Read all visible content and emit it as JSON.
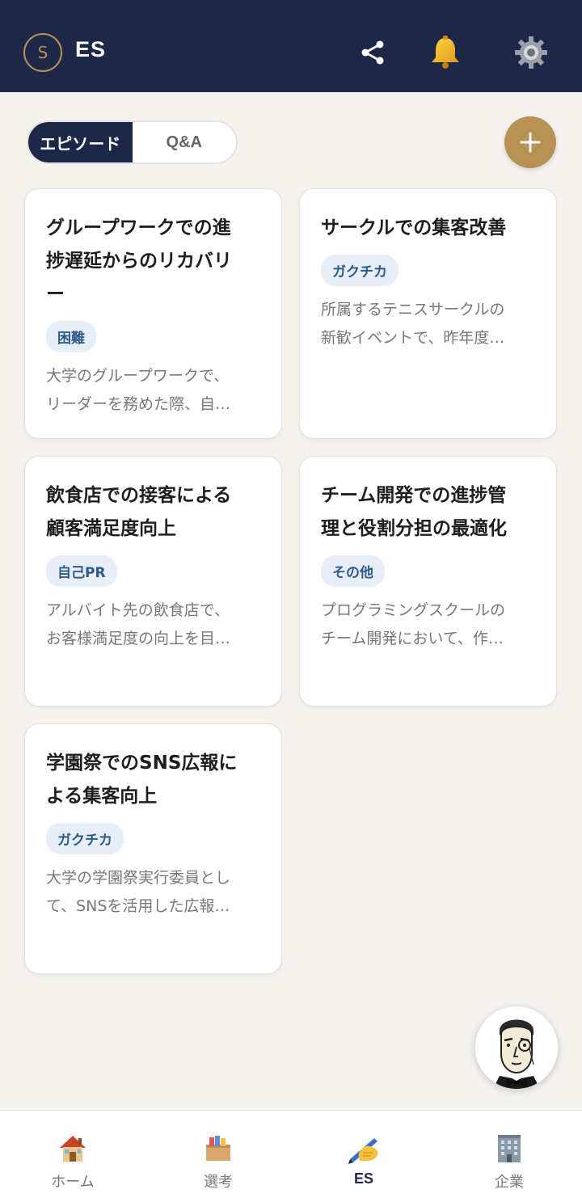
{
  "header": {
    "logo_letter": "S",
    "title": "ES",
    "icons": [
      "share-icon",
      "bell-icon",
      "gear-icon"
    ]
  },
  "segment": {
    "tabs": [
      {
        "label": "エピソード",
        "active": true
      },
      {
        "label": "Q&A",
        "active": false
      }
    ]
  },
  "add_button": {
    "icon": "plus-icon"
  },
  "cards": [
    {
      "title": "グループワークでの進捗遅延からのリカバリー",
      "title_lines": [
        "グループワークでの進",
        "捗遅延からのリカバリ",
        "ー"
      ],
      "tag": "困難",
      "desc_lines": [
        "大学のグループワークで、",
        "リーダーを務めた際、自…"
      ]
    },
    {
      "title": "サークルでの集客改善",
      "title_lines": [
        "サークルでの集客改善"
      ],
      "tag": "ガクチカ",
      "desc_lines": [
        "所属するテニスサークルの",
        "新歓イベントで、昨年度…"
      ]
    },
    {
      "title": "飲食店での接客による顧客満足度向上",
      "title_lines": [
        "飲食店での接客による",
        "顧客満足度向上"
      ],
      "tag": "自己PR",
      "desc_lines": [
        "アルバイト先の飲食店で、",
        "お客様満足度の向上を目…"
      ]
    },
    {
      "title": "チーム開発での進捗管理と役割分担の最適化",
      "title_lines": [
        "チーム開発での進捗管",
        "理と役割分担の最適化"
      ],
      "tag": "その他",
      "desc_lines": [
        "プログラミングスクールの",
        "チーム開発において、作…"
      ]
    },
    {
      "title": "学園祭でのSNS広報による集客向上",
      "title_lines": [
        "学園祭でのSNS広報に",
        "よる集客向上"
      ],
      "tag": "ガクチカ",
      "desc_lines": [
        "大学の学園祭実行委員とし",
        "て、SNSを活用した広報…"
      ]
    }
  ],
  "assistant": {
    "icon": "butler-avatar-icon"
  },
  "bottom_nav": [
    {
      "label": "ホーム",
      "icon": "house-icon",
      "active": false
    },
    {
      "label": "選考",
      "icon": "card-box-icon",
      "active": false
    },
    {
      "label": "ES",
      "icon": "writing-hand-icon",
      "active": true
    },
    {
      "label": "企業",
      "icon": "office-building-icon",
      "active": false
    }
  ],
  "colors": {
    "header_bg": "#1d2748",
    "accent_gold": "#b89155",
    "page_bg": "#f5f3ee",
    "tag_bg": "#e7eef7",
    "tag_text": "#2d5b8a"
  }
}
